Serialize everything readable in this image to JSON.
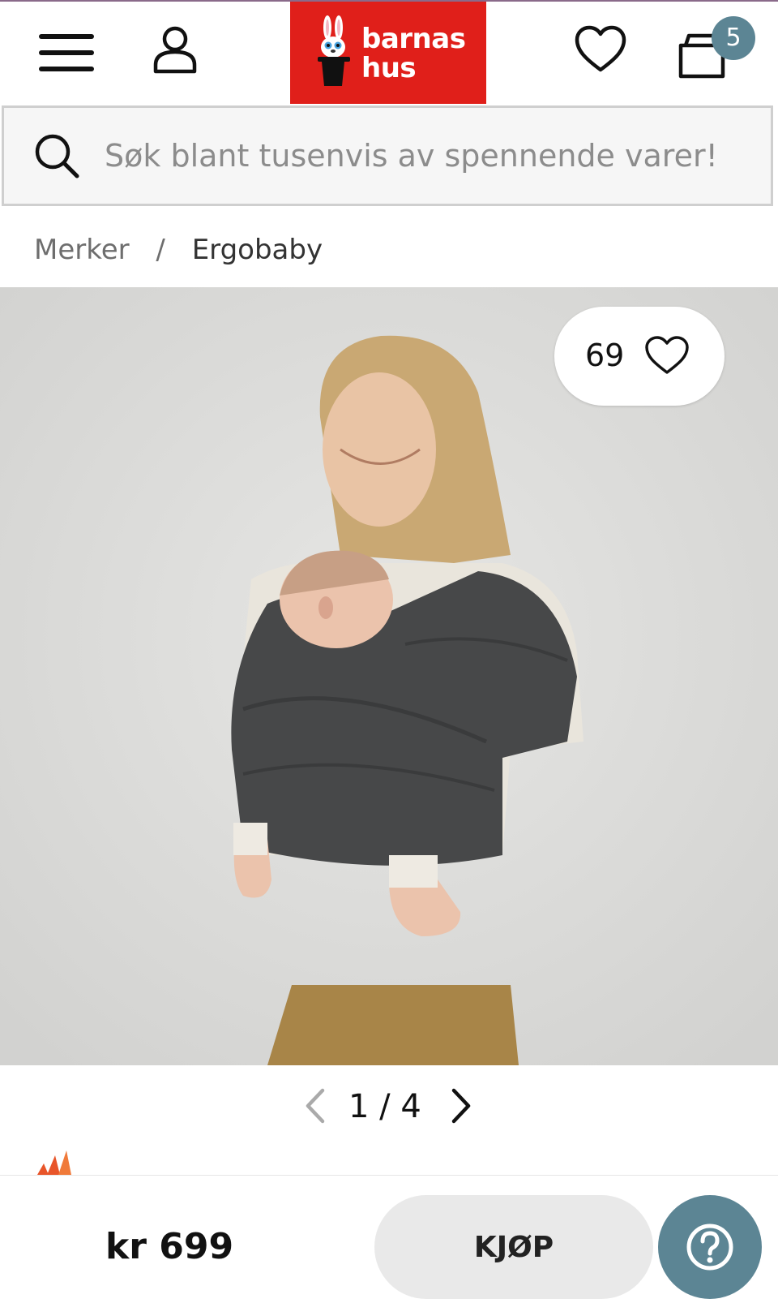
{
  "header": {
    "cart_count": "5",
    "logo": {
      "line1": "barnas",
      "line2": "hus"
    }
  },
  "search": {
    "placeholder": "Søk blant tusenvis av spennende varer!"
  },
  "breadcrumb": {
    "items": [
      "Merker",
      "Ergobaby"
    ],
    "separator": "/"
  },
  "product": {
    "likes": "69",
    "pager": {
      "text": "1 / 4"
    },
    "price": "kr 699",
    "buy_label": "KJØP"
  },
  "colors": {
    "brand_red": "#e01f1a",
    "badge_teal": "#5c8594",
    "buy_button_bg": "#e9e9e9"
  },
  "icons": [
    "hamburger-icon",
    "user-icon",
    "heart-icon",
    "cart-icon",
    "search-icon",
    "chevron-left-icon",
    "chevron-right-icon",
    "help-icon"
  ]
}
